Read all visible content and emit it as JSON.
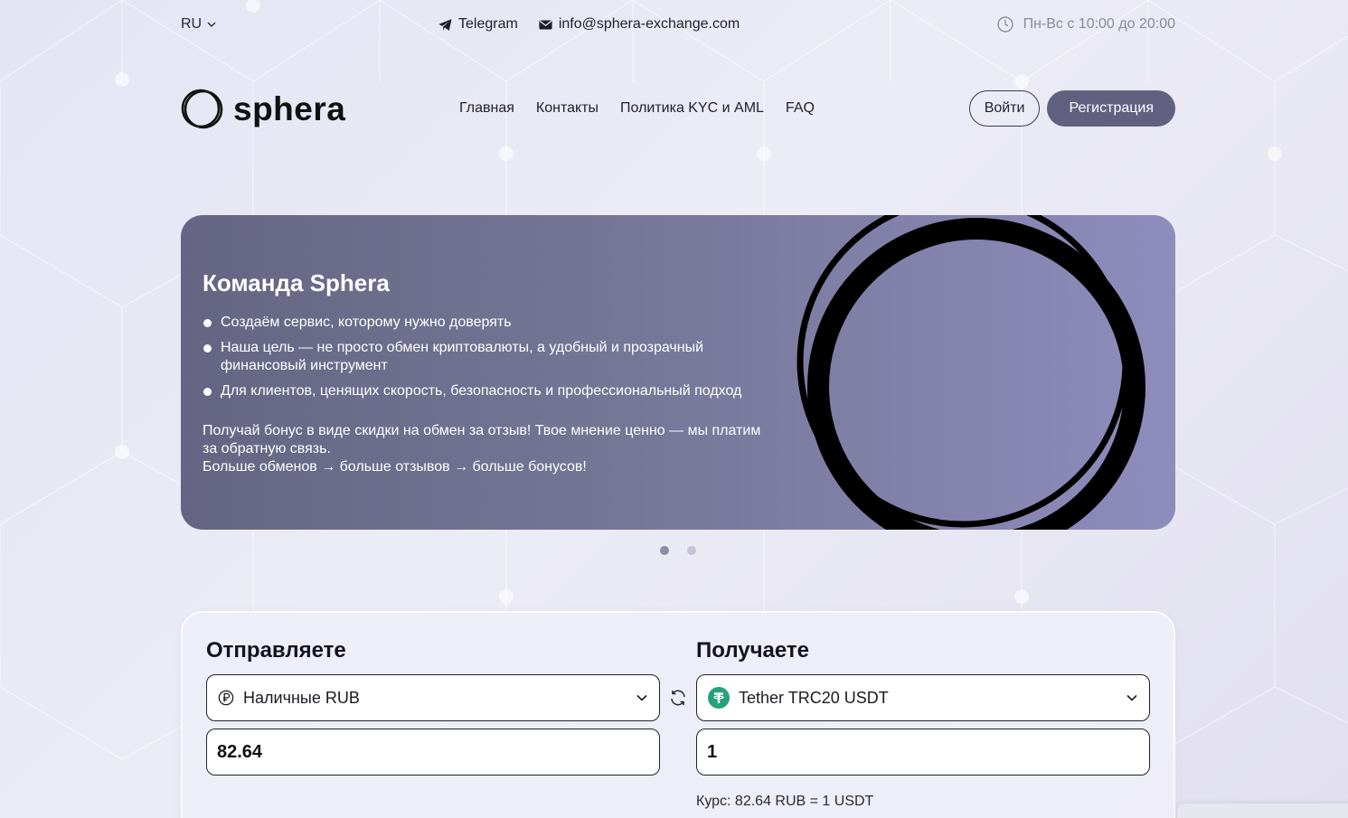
{
  "topbar": {
    "lang": "RU",
    "telegram": "Telegram",
    "email": "info@sphera-exchange.com",
    "hours": "Пн-Вс с 10:00 до 20:00"
  },
  "header": {
    "logo": "sphera",
    "nav": [
      "Главная",
      "Контакты",
      "Политика KYC и AML",
      "FAQ"
    ],
    "login": "Войти",
    "register": "Регистрация"
  },
  "banner": {
    "title": "Команда Sphera",
    "bullets": [
      "Создаём сервис, которому нужно доверять",
      "Наша цель — не просто обмен криптовалюты, а удобный и прозрачный финансовый инструмент",
      "Для клиентов, ценящих скорость, безопасность и профессиональный подход"
    ],
    "promo_line1": "Получай бонус в виде скидки на обмен за отзыв! Твое мнение ценно — мы платим за обратную связь.",
    "promo_line2": "Больше обменов → больше отзывов → больше бонусов!",
    "slide_count": 2,
    "active_slide": 1
  },
  "exchange": {
    "send_title": "Отправляете",
    "send_currency": "Наличные RUB",
    "send_amount": "82.64",
    "receive_title": "Получаете",
    "receive_currency": "Tether TRC20 USDT",
    "receive_amount": "1",
    "rate": "Курс: 82.64 RUB = 1 USDT"
  },
  "colors": {
    "accent": "#616080",
    "banner_start": "#656583",
    "banner_end": "#8e8cbc",
    "tether": "#26a17b"
  }
}
